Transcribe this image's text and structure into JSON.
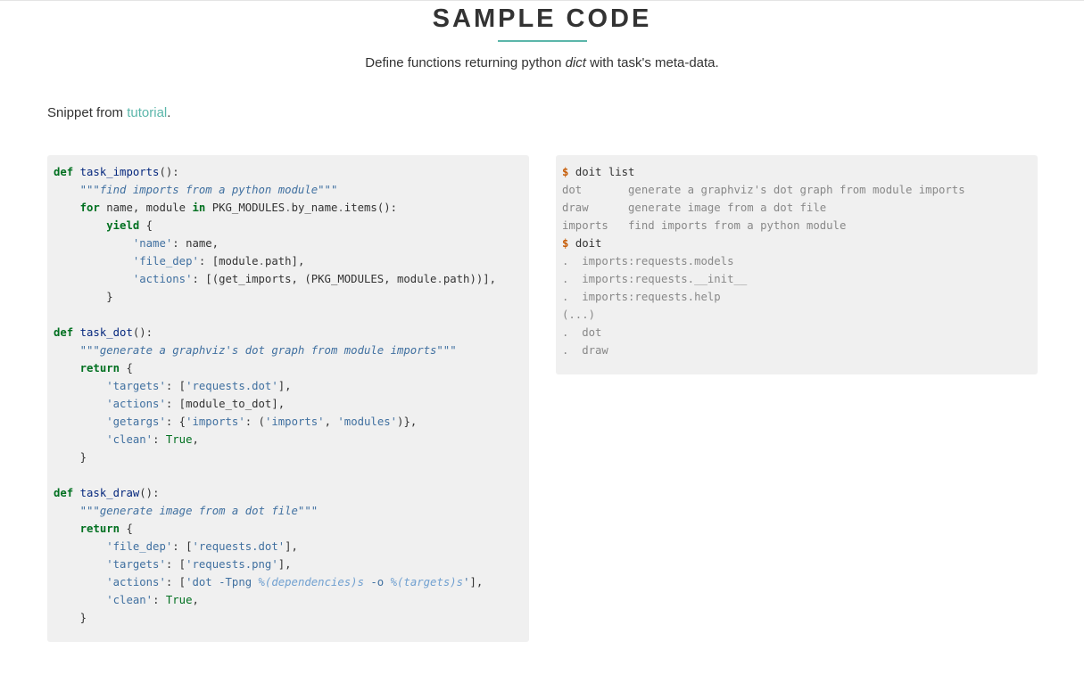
{
  "header": {
    "title": "SAMPLE CODE",
    "subtitle_before": "Define functions returning python ",
    "subtitle_em": "dict",
    "subtitle_after": " with task's meta-data."
  },
  "snippet": {
    "prefix": "Snippet from ",
    "link_label": "tutorial",
    "suffix": "."
  },
  "python_code": {
    "kw_def": "def",
    "kw_for": "for",
    "kw_in": "in",
    "kw_yield": "yield",
    "kw_return": "return",
    "kw_true": "True",
    "fn_imports": "task_imports",
    "fn_dot": "task_dot",
    "fn_draw": "task_draw",
    "doc_imports": "\"\"\"find imports from a python module\"\"\"",
    "doc_dot": "\"\"\"generate a graphviz's dot graph from module imports\"\"\"",
    "doc_draw": "\"\"\"generate image from a dot file\"\"\"",
    "str_name": "'name'",
    "str_file_dep": "'file_dep'",
    "str_actions": "'actions'",
    "str_targets": "'targets'",
    "str_getargs": "'getargs'",
    "str_imports": "'imports'",
    "str_modules": "'modules'",
    "str_clean": "'clean'",
    "str_requests_dot": "'requests.dot'",
    "str_requests_png": "'requests.png'",
    "str_cmd_start": "'dot -Tpng ",
    "interp_deps": "%(dependencies)s",
    "str_cmd_mid": " -o ",
    "interp_targets": "%(targets)s",
    "str_cmd_end": "'"
  },
  "shell_output": {
    "prompt": "$",
    "cmd_list": "doit list",
    "cmd_run": "doit",
    "list_rows": [
      "dot       generate a graphviz's dot graph from module imports",
      "draw      generate image from a dot file",
      "imports   find imports from a python module"
    ],
    "run_rows": [
      ".  imports:requests.models",
      ".  imports:requests.__init__",
      ".  imports:requests.help",
      "(...)",
      ".  dot",
      ".  draw"
    ]
  }
}
